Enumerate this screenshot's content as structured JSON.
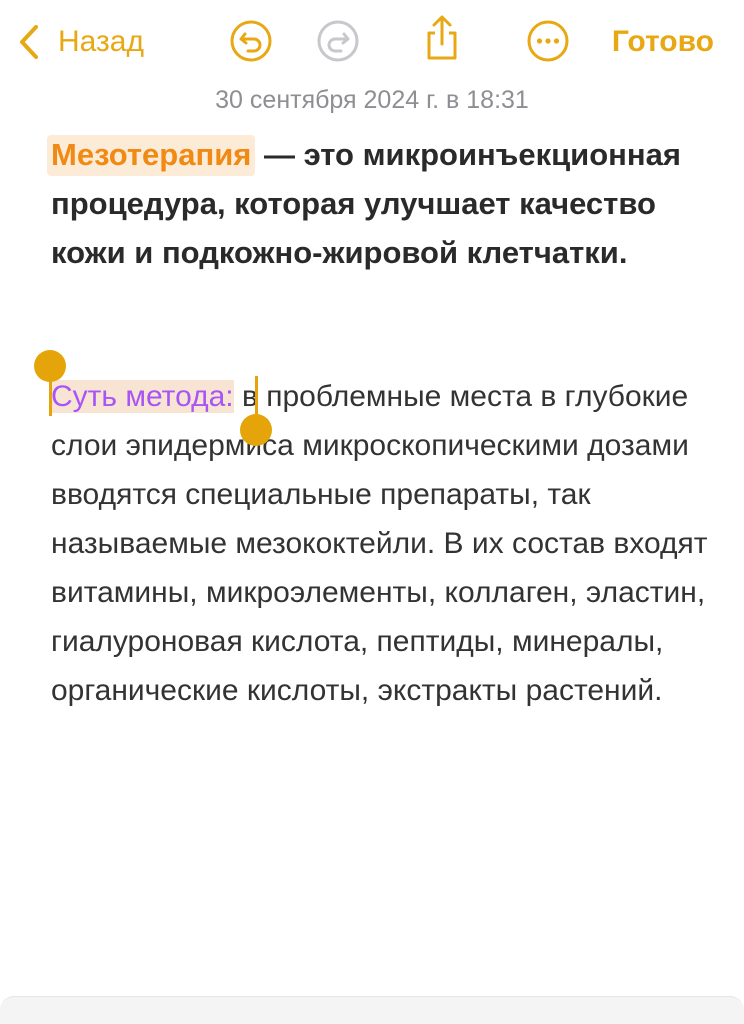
{
  "toolbar": {
    "back_label": "Назад",
    "done_label": "Готово",
    "icons": [
      "chevron-left-icon",
      "undo-icon",
      "redo-icon",
      "share-icon",
      "more-icon"
    ],
    "accent_color": "#E8A813"
  },
  "note": {
    "timestamp": "30 сентября 2024 г. в 18:31",
    "title_highlight": "Мезотерапия",
    "title_rest": " — это микроинъекционная процедура, которая улучшает качество кожи и подкожно-жировой клетчатки.",
    "body_selected": "Суть метода:",
    "body_rest": " в проблемные места в глубокие слои эпидермиса микроскопическими дозами вводятся специальные препараты, так называемые мезококтейли. В их состав входят витамины, микроэлементы, коллаген, эластин, гиалуроновая кислота, пептиды, минералы, органические кислоты, экстракты растений.",
    "highlight_color": "#F08A14",
    "selection_text_color": "#A855F7"
  }
}
